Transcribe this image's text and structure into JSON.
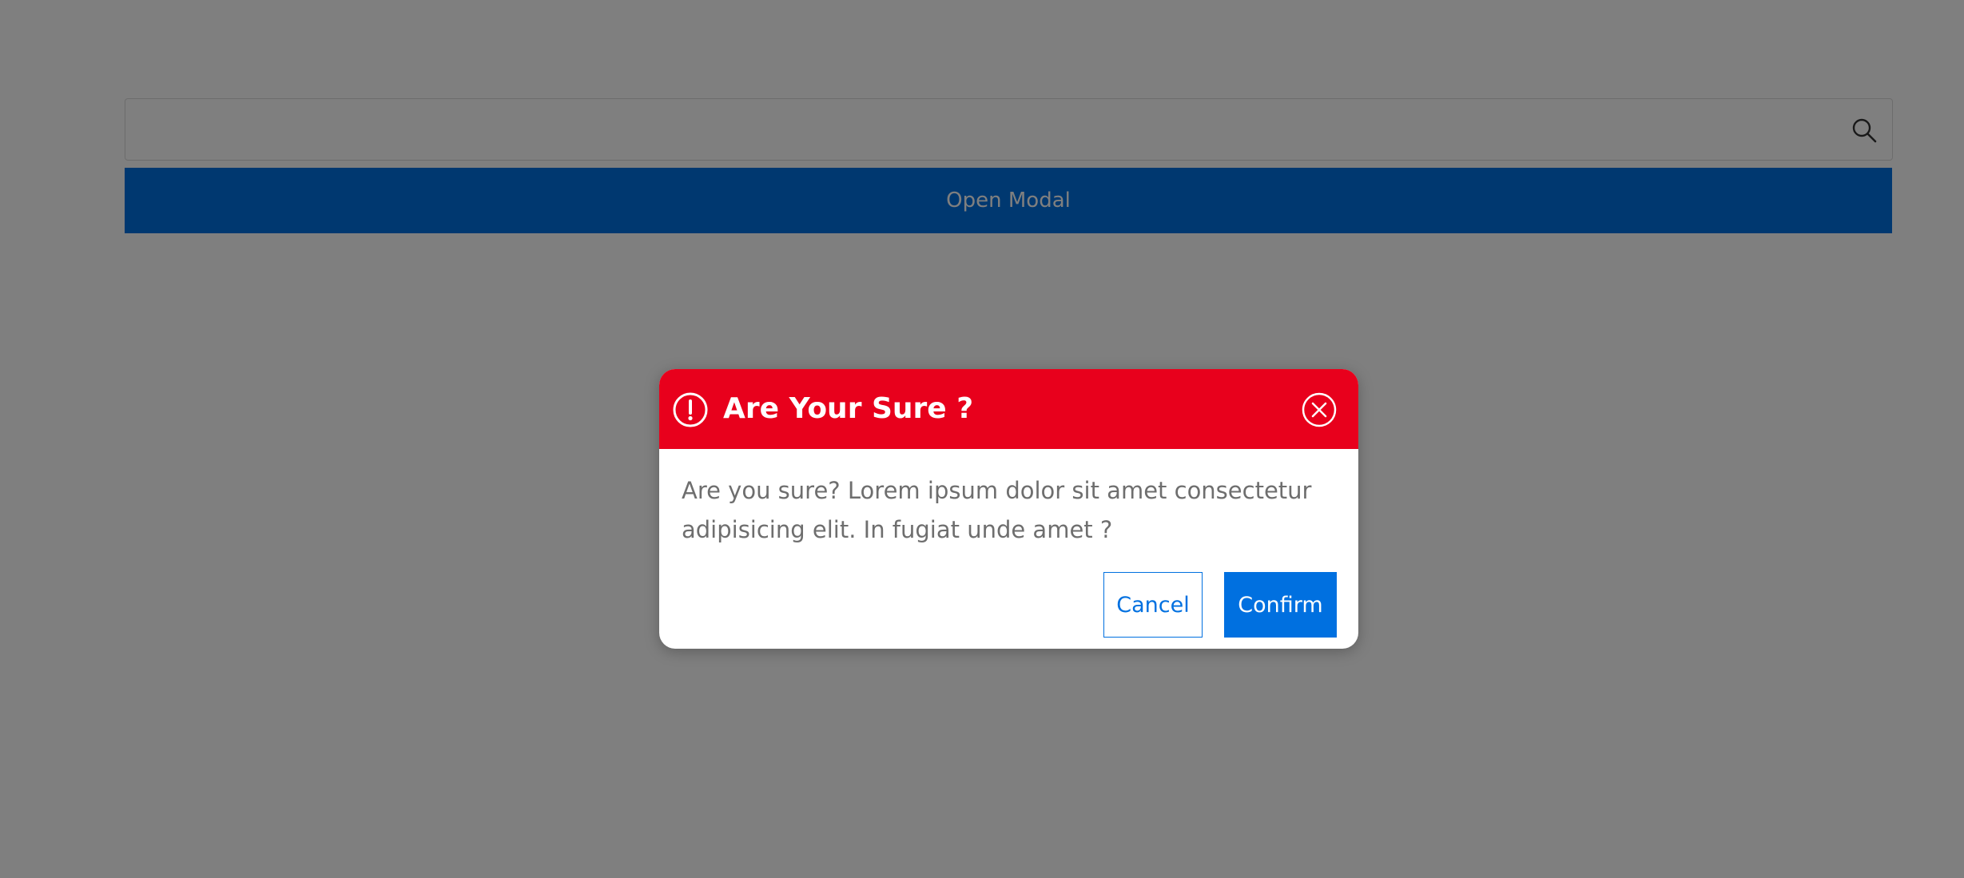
{
  "page": {
    "search": {
      "value": "",
      "placeholder": "",
      "icon": "search-icon"
    },
    "open_modal_label": "Open Modal"
  },
  "modal": {
    "title": "Are Your Sure ?",
    "title_icon": "alert-circle-icon",
    "close_icon": "close-circle-icon",
    "message": "Are you sure? Lorem ipsum dolor sit amet consectetur adipisicing elit. In fugiat unde amet ?",
    "cancel_label": "Cancel",
    "confirm_label": "Confirm"
  },
  "colors": {
    "overlay": "rgba(0,0,0,0.5)",
    "header_red": "#e8001c",
    "primary_blue": "#0070e0",
    "body_text": "#6e6e6e"
  }
}
